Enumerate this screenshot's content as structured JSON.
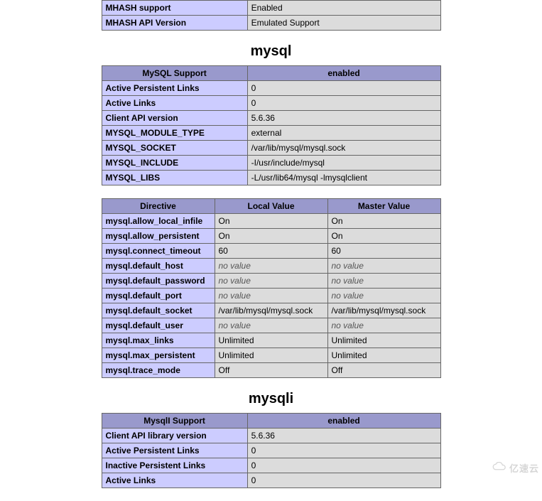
{
  "top_rows": [
    {
      "k": "MHASH support",
      "v": "Enabled"
    },
    {
      "k": "MHASH API Version",
      "v": "Emulated Support"
    }
  ],
  "mysql": {
    "heading": "mysql",
    "support_header": [
      "MySQL Support",
      "enabled"
    ],
    "info_rows": [
      {
        "k": "Active Persistent Links",
        "v": "0"
      },
      {
        "k": "Active Links",
        "v": "0"
      },
      {
        "k": "Client API version",
        "v": "5.6.36"
      },
      {
        "k": "MYSQL_MODULE_TYPE",
        "v": "external"
      },
      {
        "k": "MYSQL_SOCKET",
        "v": "/var/lib/mysql/mysql.sock"
      },
      {
        "k": "MYSQL_INCLUDE",
        "v": "-I/usr/include/mysql"
      },
      {
        "k": "MYSQL_LIBS",
        "v": "-L/usr/lib64/mysql -lmysqlclient"
      }
    ],
    "dir_header": [
      "Directive",
      "Local Value",
      "Master Value"
    ],
    "dir_rows": [
      {
        "k": "mysql.allow_local_infile",
        "l": "On",
        "m": "On"
      },
      {
        "k": "mysql.allow_persistent",
        "l": "On",
        "m": "On"
      },
      {
        "k": "mysql.connect_timeout",
        "l": "60",
        "m": "60"
      },
      {
        "k": "mysql.default_host",
        "l": "no value",
        "m": "no value",
        "nv": true
      },
      {
        "k": "mysql.default_password",
        "l": "no value",
        "m": "no value",
        "nv": true
      },
      {
        "k": "mysql.default_port",
        "l": "no value",
        "m": "no value",
        "nv": true
      },
      {
        "k": "mysql.default_socket",
        "l": "/var/lib/mysql/mysql.sock",
        "m": "/var/lib/mysql/mysql.sock"
      },
      {
        "k": "mysql.default_user",
        "l": "no value",
        "m": "no value",
        "nv": true
      },
      {
        "k": "mysql.max_links",
        "l": "Unlimited",
        "m": "Unlimited"
      },
      {
        "k": "mysql.max_persistent",
        "l": "Unlimited",
        "m": "Unlimited"
      },
      {
        "k": "mysql.trace_mode",
        "l": "Off",
        "m": "Off"
      }
    ]
  },
  "mysqli": {
    "heading": "mysqli",
    "support_header": [
      "MysqlI Support",
      "enabled"
    ],
    "info_rows": [
      {
        "k": "Client API library version",
        "v": "5.6.36"
      },
      {
        "k": "Active Persistent Links",
        "v": "0"
      },
      {
        "k": "Inactive Persistent Links",
        "v": "0"
      },
      {
        "k": "Active Links",
        "v": "0"
      }
    ]
  },
  "watermark": "亿速云"
}
